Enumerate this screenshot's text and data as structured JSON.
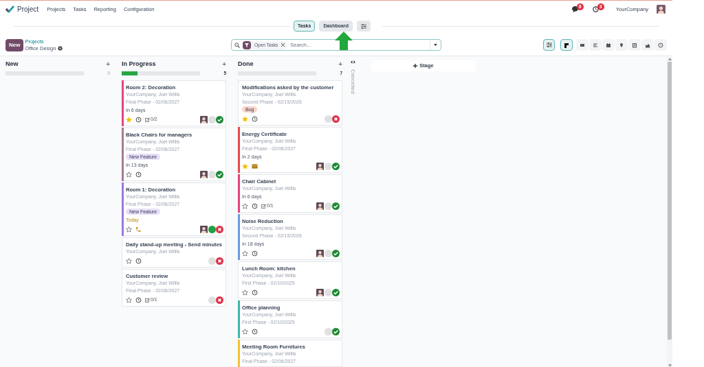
{
  "app": {
    "name": "Project"
  },
  "menu": [
    {
      "label": "Projects"
    },
    {
      "label": "Tasks"
    },
    {
      "label": "Reporting"
    },
    {
      "label": "Configuration"
    }
  ],
  "systray": {
    "messages_badge": "8",
    "activities_badge": "3",
    "company": "YourCompany"
  },
  "top_tabs": [
    {
      "label": "Tasks",
      "selected": true
    },
    {
      "label": "Dashboard",
      "selected": false
    }
  ],
  "new_button": "New",
  "breadcrumb": {
    "parent": "Projects",
    "current": "Office Design"
  },
  "search": {
    "facets": [
      {
        "label": "Open Tasks"
      }
    ],
    "placeholder": "Search..."
  },
  "views": [
    {
      "kind": "kanban",
      "selected": true
    },
    {
      "kind": "list",
      "selected": false
    },
    {
      "kind": "gantt",
      "selected": false
    },
    {
      "kind": "calendar",
      "selected": false
    },
    {
      "kind": "map",
      "selected": false
    },
    {
      "kind": "pivot",
      "selected": false
    },
    {
      "kind": "graph",
      "selected": false
    },
    {
      "kind": "activity",
      "selected": false
    }
  ],
  "columns": [
    {
      "title": "New",
      "add_label": "+",
      "count": "0",
      "level": 0
    },
    {
      "title": "In Progress",
      "add_label": "+",
      "count": "5",
      "level": 0.2,
      "cards": [
        {
          "title": "Room 2: Decoration",
          "company": "YourCompany, Joel Willis",
          "phase": "Final Phase - 02/06/2027",
          "deadline": "In 6 days",
          "deadline_today": false,
          "starred": true,
          "activity": {
            "kind": "clock"
          },
          "checklist": "0/2",
          "avatar": true,
          "status": {
            "color": "#e0e0e0"
          },
          "done": true,
          "color": "#e6447e"
        },
        {
          "title": "Black Chairs for managers",
          "company": "YourCompany, Joel Willis",
          "phase": "Final Phase - 02/06/2027",
          "tag": {
            "label": "New Feature",
            "color": "#e9def8"
          },
          "deadline": "In 13 days",
          "deadline_today": false,
          "starred": false,
          "activity": {
            "kind": "clock"
          },
          "avatar": true,
          "status": {
            "color": "#e0e0e0"
          },
          "done": true,
          "color": "#a67d92"
        },
        {
          "title": "Room 1: Decoration",
          "company": "YourCompany, Joel Willis",
          "phase": "Final Phase - 02/06/2027",
          "tag": {
            "label": "New Feature",
            "color": "#e9def8"
          },
          "deadline": "Today",
          "deadline_today": true,
          "starred": false,
          "activity": {
            "kind": "phone"
          },
          "avatar": true,
          "status": {
            "color": "#21a144"
          },
          "done": false,
          "color": "#9b78e0"
        },
        {
          "title": "Daily stand-up meeting - Send minutes",
          "company": "YourCompany, Joel Willis",
          "starred": false,
          "activity": {
            "kind": "clock"
          },
          "avatar": false,
          "status": {
            "color": "#e0e0e0"
          },
          "done": false
        },
        {
          "title": "Customer review",
          "company": "YourCompany, Joel Willis",
          "phase": "Final Phase - 02/06/2027",
          "starred": false,
          "activity": {
            "kind": "clock"
          },
          "checklist": "0/1",
          "avatar": false,
          "status": {
            "color": "#e0e0e0"
          },
          "done": false
        }
      ]
    },
    {
      "title": "Done",
      "add_label": "+",
      "count": "7",
      "level": 0,
      "cards": [
        {
          "title": "Modifications asked by the customer",
          "company": "YourCompany, Joel Willis",
          "phase": "Second Phase - 02/15/2026",
          "tag": {
            "label": "Bug",
            "color": "#f9d4c8"
          },
          "starred": true,
          "activity": {
            "kind": "clock"
          },
          "avatar": false,
          "status": {
            "color": "#e0e0e0"
          },
          "done": false
        },
        {
          "title": "Energy Certificate",
          "company": "YourCompany, Joel Willis",
          "phase": "Final Phase - 02/06/2027",
          "deadline": "In 2 days",
          "deadline_today": false,
          "starred": true,
          "activity": {
            "kind": "mail"
          },
          "avatar": true,
          "status": {
            "color": "#e0e0e0"
          },
          "done": true,
          "color": "#e84a4a"
        },
        {
          "title": "Chair Cabinet",
          "company": "YourCompany, Joel Willis",
          "deadline": "In 6 days",
          "deadline_today": false,
          "starred": false,
          "activity": {
            "kind": "clock"
          },
          "checklist": "0/1",
          "avatar": true,
          "status": {
            "color": "#e0e0e0"
          },
          "done": true,
          "color": "#e6447e"
        },
        {
          "title": "Noise Reduction",
          "company": "YourCompany, Joel Willis",
          "phase": "Second Phase - 02/15/2026",
          "deadline": "In 18 days",
          "deadline_today": false,
          "starred": false,
          "activity": {
            "kind": "clock"
          },
          "avatar": true,
          "status": {
            "color": "#e0e0e0"
          },
          "done": true,
          "color": "#6a9be0"
        },
        {
          "title": "Lunch Room: kitchen",
          "company": "YourCompany, Joel Willis",
          "phase": "First Phase - 02/10/2025",
          "starred": false,
          "activity": {
            "kind": "clock"
          },
          "avatar": true,
          "status": {
            "color": "#e0e0e0"
          },
          "done": true
        },
        {
          "title": "Office planning",
          "company": "YourCompany, Joel Willis",
          "phase": "First Phase - 02/10/2025",
          "starred": false,
          "activity": {
            "kind": "clock"
          },
          "avatar": false,
          "status": {
            "color": "#e0e0e0"
          },
          "done": true,
          "color": "#3db8a6"
        },
        {
          "title": "Meeting Room Furnitures",
          "company": "YourCompany, Joel Willis",
          "phase": "Final Phase - 02/06/2027",
          "color": "#f2c230"
        }
      ]
    }
  ],
  "folded_columns": [
    {
      "title": "Cancelled"
    }
  ],
  "add_stage": "Stage"
}
